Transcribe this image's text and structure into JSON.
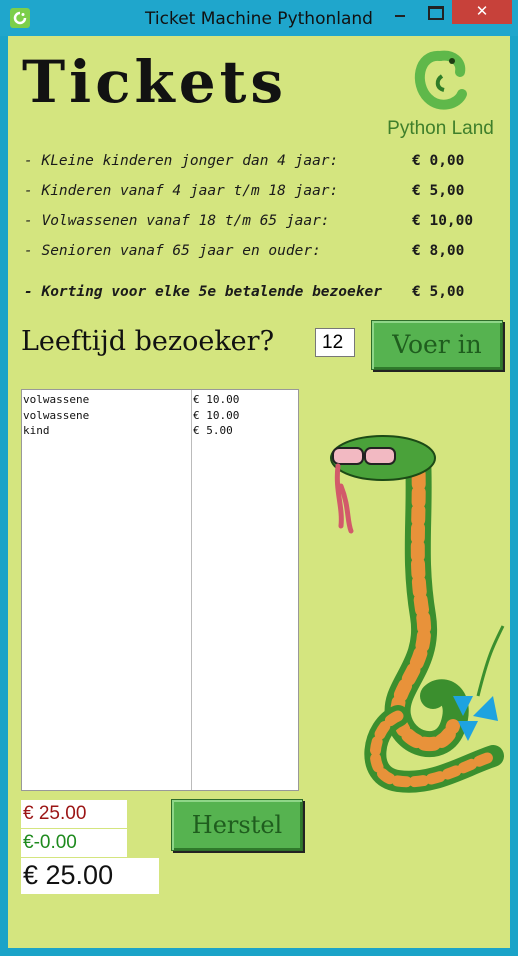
{
  "window": {
    "title": "Ticket Machine Pythonland",
    "close_label": "✕"
  },
  "header": {
    "title": "Tickets",
    "logo_text": "Python Land"
  },
  "prices": [
    {
      "label": "- KLeine kinderen jonger dan 4 jaar:",
      "amount": "€ 0,00"
    },
    {
      "label": "- Kinderen vanaf 4 jaar t/m 18 jaar:",
      "amount": "€ 5,00"
    },
    {
      "label": "- Volwassenen vanaf 18 t/m 65 jaar:",
      "amount": "€ 10,00"
    },
    {
      "label": "- Senioren vanaf 65 jaar en ouder:",
      "amount": "€ 8,00"
    }
  ],
  "discount": {
    "label": "- Korting voor elke 5e betalende bezoeker",
    "amount": "€ 5,00"
  },
  "age_prompt": {
    "label": "Leeftijd bezoeker?",
    "value": "12",
    "button_label": "Voer in"
  },
  "tickets": {
    "types": [
      "volwassene",
      "volwassene",
      "kind"
    ],
    "prices": [
      "€ 10.00",
      "€ 10.00",
      "€ 5.00"
    ]
  },
  "totals": {
    "subtotal": "€ 25.00",
    "discount": "€-0.00",
    "total": "€ 25.00"
  },
  "reset_button_label": "Herstel",
  "colors": {
    "background": "#d4e57f",
    "button": "#56b350",
    "subtotal": "#9b1515",
    "discount": "#1e8a1e"
  },
  "icons": {
    "app": "python-land-logo-icon",
    "mascot": "snake-illustration"
  }
}
